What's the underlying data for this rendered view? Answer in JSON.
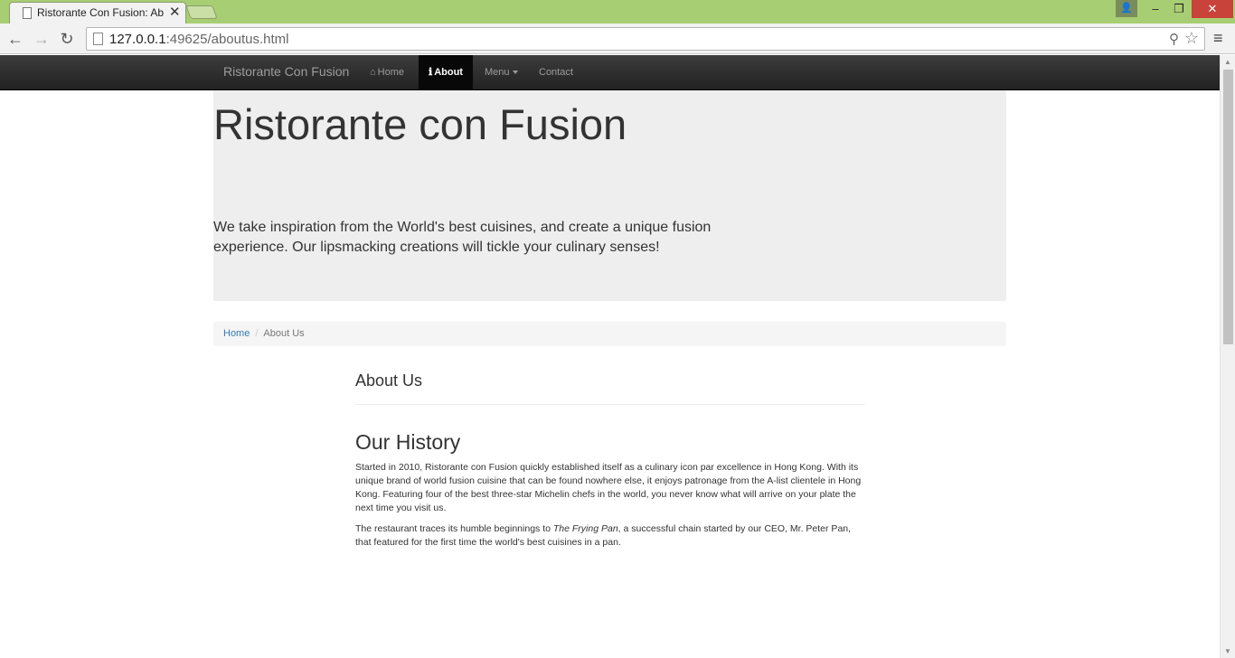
{
  "browser": {
    "tab_title": "Ristorante Con Fusion: About Us",
    "url_host": "127.0.0.1",
    "url_rest": ":49625/aboutus.html",
    "close_glyph": "✕"
  },
  "navbar": {
    "brand": "Ristorante Con Fusion",
    "items": [
      {
        "label": "Home",
        "icon": "home-icon"
      },
      {
        "label": "About",
        "icon": "info-icon",
        "active": true
      },
      {
        "label": "Menu",
        "icon": "dropdown-caret"
      },
      {
        "label": "Contact"
      }
    ]
  },
  "jumbotron": {
    "title": "Ristorante con Fusion",
    "tagline": "We take inspiration from the World's best cuisines, and create a unique fusion experience. Our lipsmacking creations will tickle your culinary senses!"
  },
  "breadcrumb": {
    "home": "Home",
    "separator": "/",
    "current": "About Us"
  },
  "content": {
    "about_heading": "About Us",
    "history_heading": "Our History",
    "para1": "Started in 2010, Ristorante con Fusion quickly established itself as a culinary icon par excellence in Hong Kong. With its unique brand of world fusion cuisine that can be found nowhere else, it enjoys patronage from the A-list clientele in Hong Kong. Featuring four of the best three-star Michelin chefs in the world, you never know what will arrive on your plate the next time you visit us.",
    "para2_before": "The restaurant traces its humble beginnings to ",
    "para2_italic": "The Frying Pan",
    "para2_after": ", a successful chain started by our CEO, Mr. Peter Pan, that featured for the first time the world's best cuisines in a pan."
  },
  "colors": {
    "titlebar": "#a8ce73",
    "navbar": "#222222",
    "jumbotron": "#eeeeee",
    "link": "#337ab7"
  }
}
